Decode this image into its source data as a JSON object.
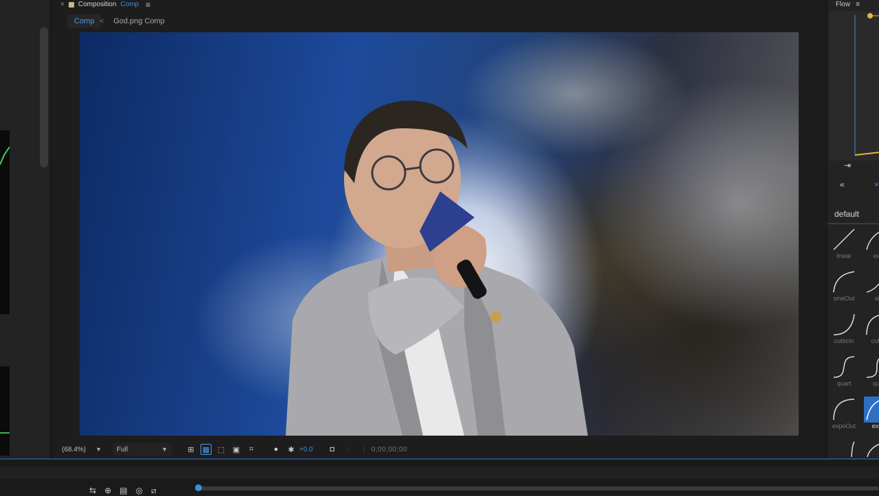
{
  "composition_panel": {
    "type_label": "Composition",
    "name": "Comp",
    "tabs": [
      {
        "label": "Comp",
        "active": true
      },
      {
        "label": "God.png Comp",
        "active": false
      }
    ]
  },
  "viewer_toolbar": {
    "zoom": "(68.4%)",
    "resolution": "Full",
    "exposure": "+0.0",
    "timecode": "0;00;00;00"
  },
  "flow_panel": {
    "title": "Flow",
    "section": "default",
    "presets": [
      {
        "label": "linear",
        "selected": false
      },
      {
        "label": "ea",
        "selected": false
      },
      {
        "label": "sineOut",
        "selected": false
      },
      {
        "label": "si",
        "selected": false
      },
      {
        "label": "cubicIn",
        "selected": false
      },
      {
        "label": "cubi",
        "selected": false
      },
      {
        "label": "quart",
        "selected": false
      },
      {
        "label": "qui",
        "selected": false
      },
      {
        "label": "expoOut",
        "selected": false
      },
      {
        "label": "exp",
        "selected": true
      }
    ]
  },
  "colors": {
    "accent": "#3a8fe0",
    "panel_bg": "#1d1d1d",
    "curve": "#e8b83c"
  },
  "icons": {
    "close": "close-icon",
    "lock": "lock-icon",
    "menu": "menu-icon",
    "back": "chevron-left-icon",
    "snapshot": "camera-icon"
  }
}
